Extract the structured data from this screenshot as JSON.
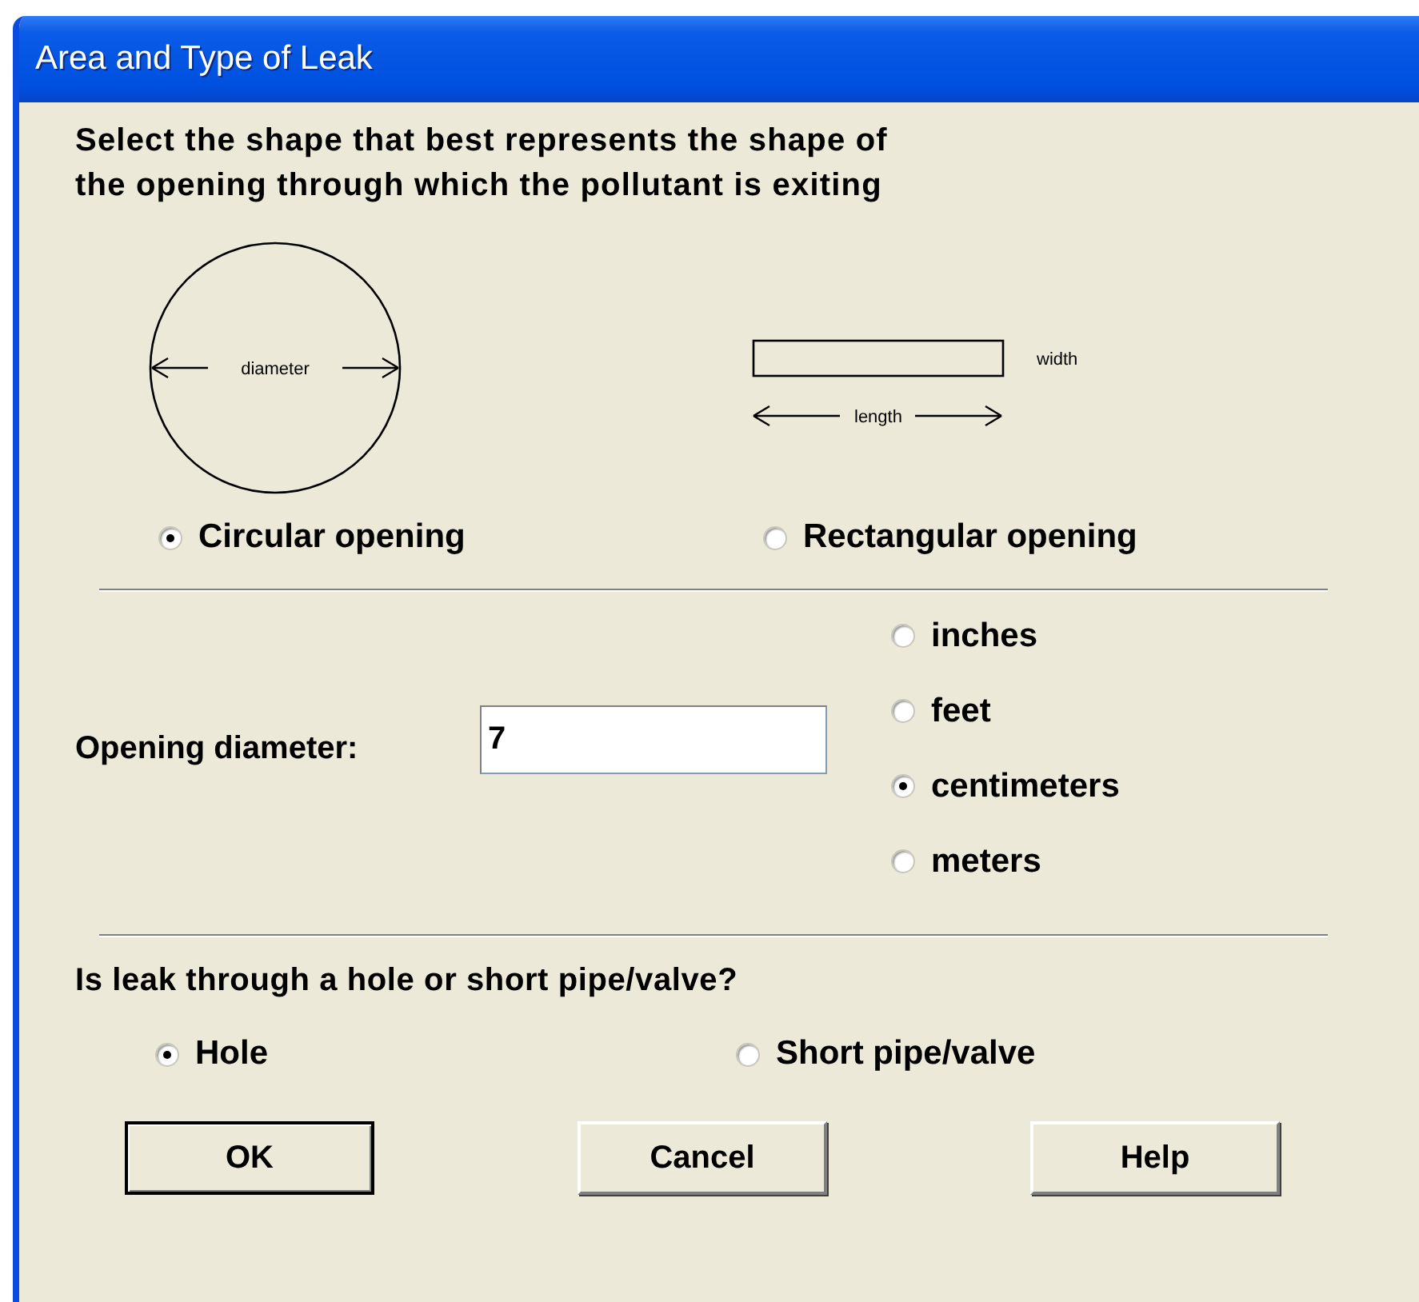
{
  "window": {
    "title": "Area and Type of Leak"
  },
  "instruction": "Select the shape that best represents the shape of\nthe opening through which the pollutant is exiting",
  "shapes": [
    {
      "kind": "circle",
      "dimension_label": "diameter",
      "option": "Circular opening",
      "selected": true
    },
    {
      "kind": "rectangle",
      "width_label": "width",
      "length_label": "length",
      "option": "Rectangular opening",
      "selected": false
    }
  ],
  "diameter": {
    "label": "Opening diameter:",
    "value": "7"
  },
  "units": [
    {
      "label": "inches",
      "selected": false
    },
    {
      "label": "feet",
      "selected": false
    },
    {
      "label": "centimeters",
      "selected": true
    },
    {
      "label": "meters",
      "selected": false
    }
  ],
  "question": "Is leak through a hole or short pipe/valve?",
  "leak_types": [
    {
      "label": "Hole",
      "selected": true
    },
    {
      "label": "Short pipe/valve",
      "selected": false
    }
  ],
  "buttons": [
    {
      "label": "OK",
      "default": true
    },
    {
      "label": "Cancel",
      "default": false
    },
    {
      "label": "Help",
      "default": false
    }
  ]
}
